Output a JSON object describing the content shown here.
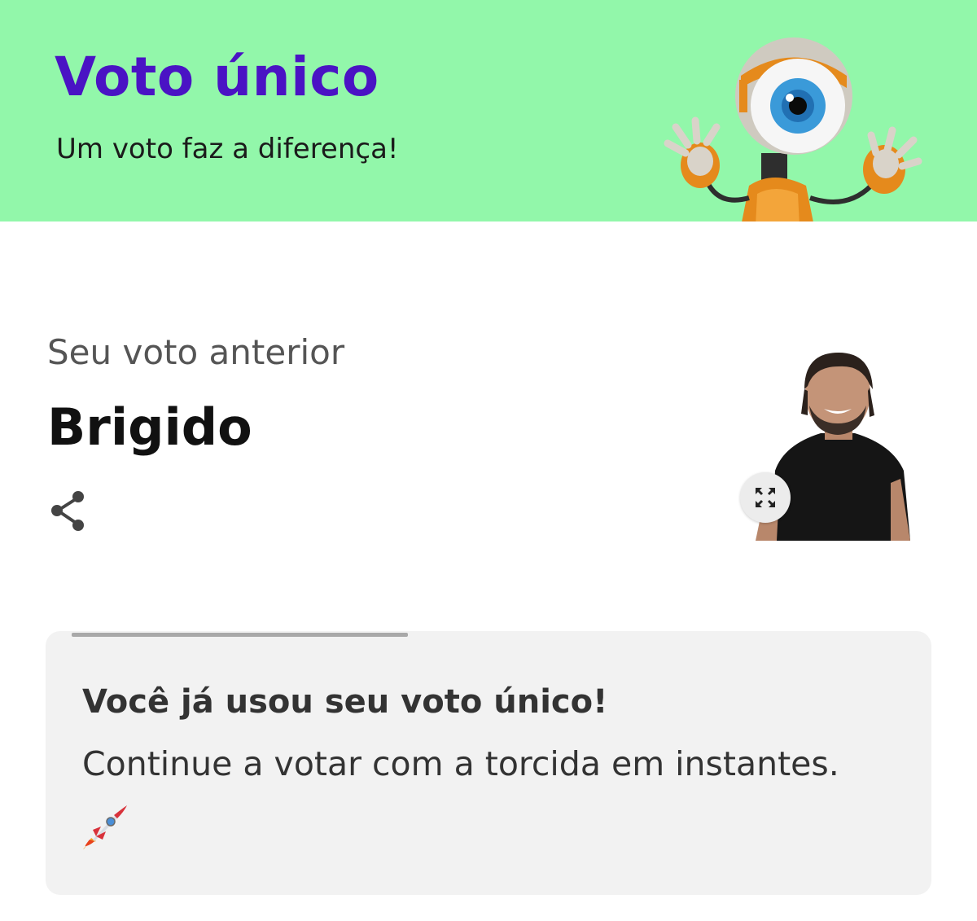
{
  "colors": {
    "banner_bg": "#92f7aa",
    "title_color": "#4a13c4",
    "card_bg": "#f2f2f2",
    "progress_bar": "#a9a9a9"
  },
  "banner": {
    "title": "Voto único",
    "subtitle": "Um voto faz a diferença!",
    "mascot_icon": "big-eye-robot-mascot"
  },
  "previous_vote": {
    "label": "Seu voto anterior",
    "name": "Brigido",
    "share_icon": "share-icon",
    "expand_icon": "expand-icon"
  },
  "notice": {
    "title": "Você já usou seu voto único!",
    "message": "Continue a votar com a torcida em instantes.",
    "emoji_icon": "rocket-icon",
    "progress": 0.38
  }
}
